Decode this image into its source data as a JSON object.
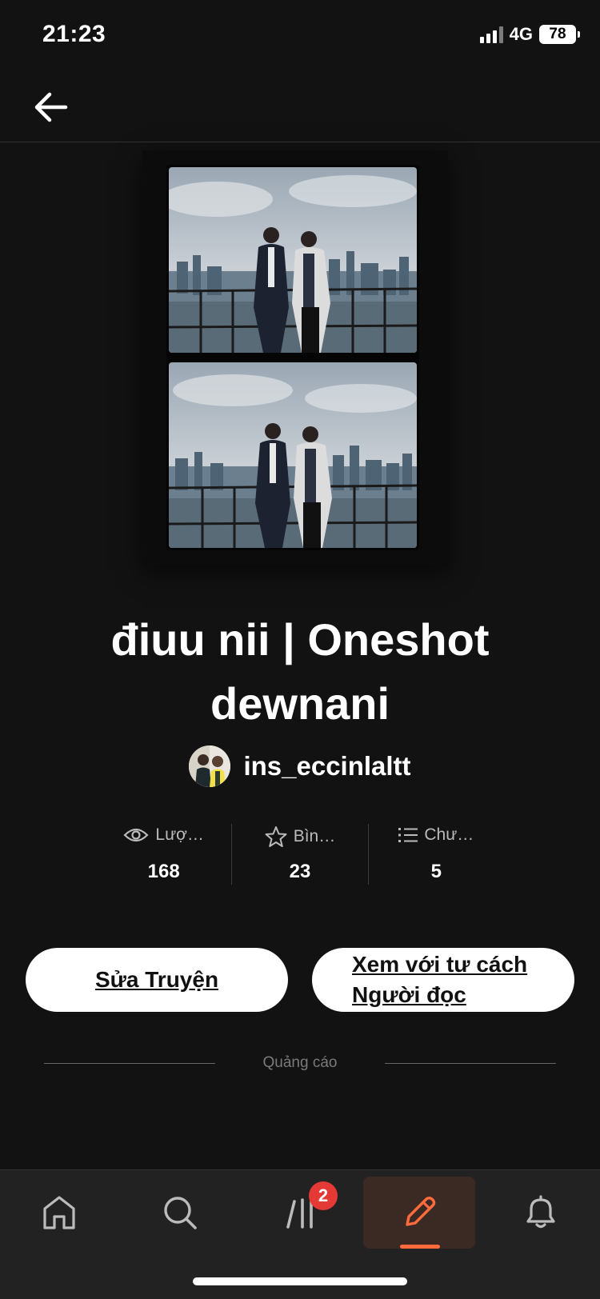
{
  "status_bar": {
    "time": "21:23",
    "network": "4G",
    "battery": "78"
  },
  "story": {
    "title": "điuu nii | Oneshot dewnani",
    "author": "ins_eccinlaltt"
  },
  "stats": [
    {
      "icon": "eye-icon",
      "label": "Lượ…",
      "value": "168"
    },
    {
      "icon": "star-icon",
      "label": "Bìn…",
      "value": "23"
    },
    {
      "icon": "list-icon",
      "label": "Chư…",
      "value": "5"
    }
  ],
  "actions": {
    "edit_label": "Sửa Truyện",
    "view_label_line1": "Xem với tư cách",
    "view_label_line2": "Người đọc"
  },
  "ad": {
    "label": "Quảng cáo"
  },
  "bottom_nav": {
    "items": [
      {
        "icon": "home-icon"
      },
      {
        "icon": "search-icon"
      },
      {
        "icon": "library-icon",
        "badge": "2"
      },
      {
        "icon": "pencil-icon",
        "active": true
      },
      {
        "icon": "bell-icon"
      }
    ]
  },
  "colors": {
    "background": "#121212",
    "accent": "#ff6b3d",
    "badge": "#e53935",
    "nav_background": "#222222"
  }
}
